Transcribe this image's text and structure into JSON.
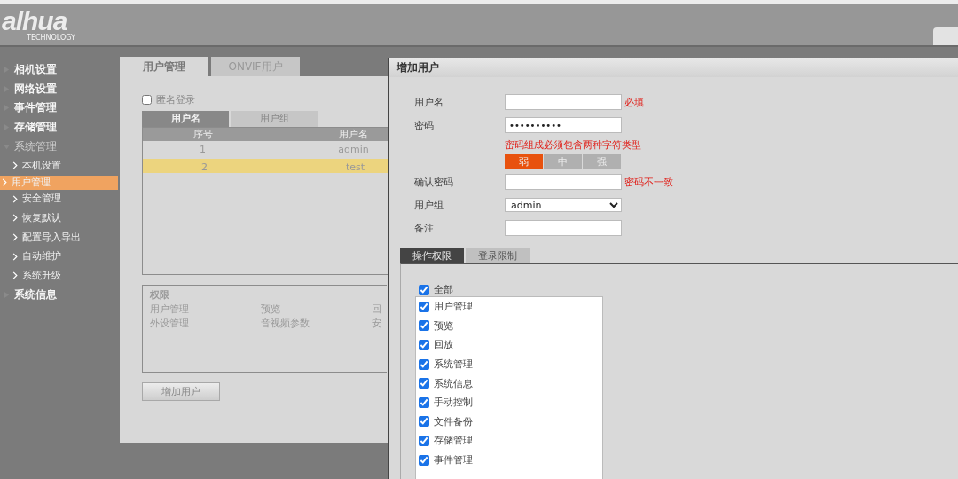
{
  "logo": {
    "brand": "alhua",
    "tagline": "TECHNOLOGY"
  },
  "sidebar": {
    "items": [
      {
        "label": "相机设置",
        "expanded": false
      },
      {
        "label": "网络设置",
        "expanded": false
      },
      {
        "label": "事件管理",
        "expanded": false
      },
      {
        "label": "存储管理",
        "expanded": false
      },
      {
        "label": "系统管理",
        "expanded": true,
        "children": [
          {
            "label": "本机设置",
            "selected": false
          },
          {
            "label": "用户管理",
            "selected": true
          },
          {
            "label": "安全管理",
            "selected": false
          },
          {
            "label": "恢复默认",
            "selected": false
          },
          {
            "label": "配置导入导出",
            "selected": false
          },
          {
            "label": "自动维护",
            "selected": false
          },
          {
            "label": "系统升级",
            "selected": false
          }
        ]
      },
      {
        "label": "系统信息",
        "expanded": false
      }
    ]
  },
  "main": {
    "tabs": [
      {
        "label": "用户管理",
        "selected": true
      },
      {
        "label": "ONVIF用户",
        "selected": false
      }
    ],
    "anonymous_login": {
      "label": "匿名登录",
      "checked": false
    },
    "subtabs": [
      {
        "label": "用户名",
        "selected": true
      },
      {
        "label": "用户组",
        "selected": false
      }
    ],
    "table": {
      "columns": [
        "序号",
        "用户名"
      ],
      "rows": [
        {
          "cells": [
            "1",
            "admin"
          ],
          "selected": false
        },
        {
          "cells": [
            "2",
            "test"
          ],
          "selected": true
        }
      ]
    },
    "permissions": {
      "title": "权限",
      "rows": [
        [
          "用户管理",
          "预览",
          "回"
        ],
        [
          "外设管理",
          "音视频参数",
          "安"
        ]
      ]
    },
    "add_button": "增加用户"
  },
  "dialog": {
    "title": "增加用户",
    "fields": [
      {
        "kind": "input",
        "label": "用户名",
        "note": "必填"
      },
      {
        "kind": "input",
        "label": "密码",
        "value": "••••••••••",
        "hint": "密码组成必须包含两种字符类型"
      },
      {
        "kind": "strength",
        "levels": [
          {
            "label": "弱",
            "selected": true
          },
          {
            "label": "中",
            "selected": false
          },
          {
            "label": "强",
            "selected": false
          }
        ]
      },
      {
        "kind": "input",
        "label": "确认密码",
        "note": "密码不一致"
      },
      {
        "kind": "select",
        "label": "用户组",
        "value": "admin"
      },
      {
        "kind": "input",
        "label": "备注"
      }
    ],
    "tabs": [
      {
        "label": "操作权限",
        "selected": true
      },
      {
        "label": "登录限制",
        "selected": false
      }
    ],
    "all": {
      "label": "全部",
      "checked": true
    },
    "rights": [
      {
        "label": "用户管理",
        "checked": true
      },
      {
        "label": "预览",
        "checked": true
      },
      {
        "label": "回放",
        "checked": true
      },
      {
        "label": "系统管理",
        "checked": true
      },
      {
        "label": "系统信息",
        "checked": true
      },
      {
        "label": "手动控制",
        "checked": true
      },
      {
        "label": "文件备份",
        "checked": true
      },
      {
        "label": "存储管理",
        "checked": true
      },
      {
        "label": "事件管理",
        "checked": true
      }
    ]
  }
}
